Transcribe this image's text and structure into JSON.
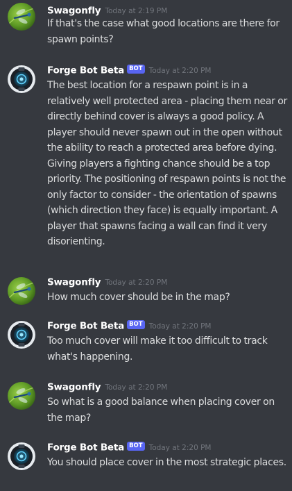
{
  "colors": {
    "background": "#36393f",
    "text": "#dcddde",
    "username": "#ffffff",
    "timestamp": "#72767d",
    "bot_tag": "#5865f2"
  },
  "messages": [
    {
      "author": "Swagonfly",
      "avatar_icon": "dragonfly-avatar-icon",
      "is_bot": false,
      "timestamp": "Today at 2:19 PM",
      "text": "If that's the case what good locations are there for spawn points?"
    },
    {
      "author": "Forge Bot Beta",
      "avatar_icon": "forge-bot-avatar-icon",
      "is_bot": true,
      "bot_tag": "BOT",
      "timestamp": "Today at 2:20 PM",
      "text": "The best location for a respawn point is in a relatively well protected area - placing them near or directly behind cover is always a good policy. A player should never spawn out in the open without the ability to reach a protected area before dying. Giving players a fighting chance should be a top priority. The positioning of respawn points is not the only factor to consider - the orientation of spawns (which direction they face) is equally important. A player that spawns facing a wall can find it very disorienting."
    },
    {
      "author": "Swagonfly",
      "avatar_icon": "dragonfly-avatar-icon",
      "is_bot": false,
      "timestamp": "Today at 2:20 PM",
      "text": "How much cover should be in the map?"
    },
    {
      "author": "Forge Bot Beta",
      "avatar_icon": "forge-bot-avatar-icon",
      "is_bot": true,
      "bot_tag": "BOT",
      "timestamp": "Today at 2:20 PM",
      "text": "Too much cover will make it too difficult to track what's happening."
    },
    {
      "author": "Swagonfly",
      "avatar_icon": "dragonfly-avatar-icon",
      "is_bot": false,
      "timestamp": "Today at 2:20 PM",
      "text": "So what is a good balance when placing cover on the map?"
    },
    {
      "author": "Forge Bot Beta",
      "avatar_icon": "forge-bot-avatar-icon",
      "is_bot": true,
      "bot_tag": "BOT",
      "timestamp": "Today at 2:20 PM",
      "text": "You should place cover in the most strategic places."
    }
  ]
}
